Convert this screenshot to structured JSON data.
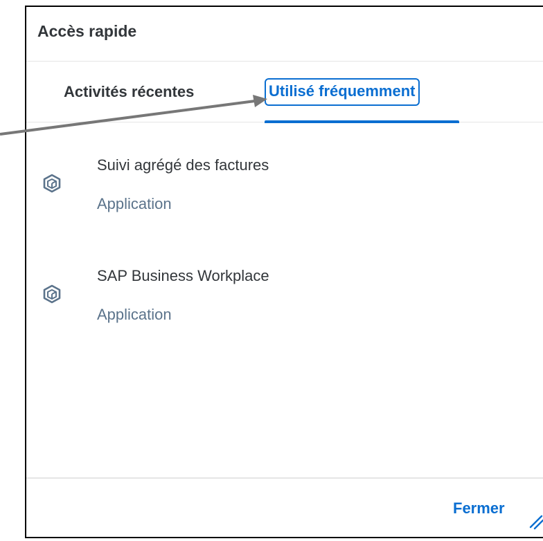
{
  "dialog": {
    "title": "Accès rapide"
  },
  "tabs": [
    {
      "label": "Activités récentes",
      "selected": false
    },
    {
      "label": "Utilisé fréquemment",
      "selected": true
    }
  ],
  "items": [
    {
      "title": "Suivi agrégé des factures",
      "subtitle": "Application",
      "icon": "app-cube-icon"
    },
    {
      "title": "SAP Business Workplace",
      "subtitle": "Application",
      "icon": "app-cube-icon"
    }
  ],
  "footer": {
    "close_label": "Fermer"
  },
  "colors": {
    "accent": "#0a6ed1",
    "text": "#32363a",
    "subtitle": "#5b738b",
    "divider": "#e5e5e5",
    "annotation": "#777777"
  }
}
